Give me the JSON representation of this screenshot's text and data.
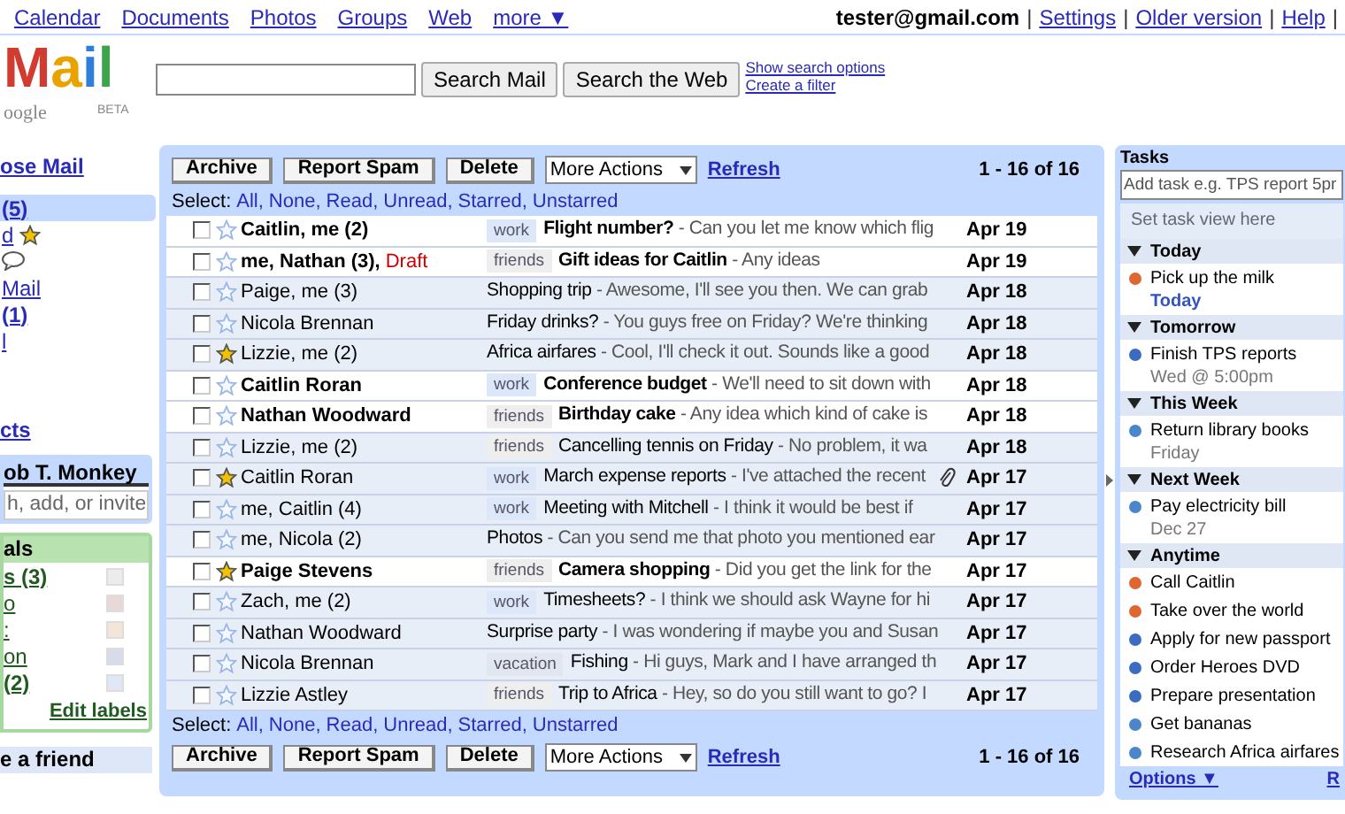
{
  "top_links": [
    "Calendar",
    "Documents",
    "Photos",
    "Groups",
    "Web",
    "more ▼"
  ],
  "account": {
    "email": "tester@gmail.com",
    "separator": "|",
    "links": [
      "Settings",
      "Older version",
      "Help"
    ]
  },
  "logo": {
    "text": "Mail",
    "sub": "oogle",
    "badge": "BETA"
  },
  "search": {
    "buttons": [
      "Search Mail",
      "Search the Web"
    ],
    "links": [
      "Show search options",
      "Create a filter"
    ]
  },
  "sidebar": {
    "compose": "ose Mail",
    "nav": [
      {
        "kind": "plain",
        "label": "(5)",
        "unread": true,
        "selected": true
      },
      {
        "kind": "starred",
        "label": "d",
        "unread": false,
        "selected": false
      },
      {
        "kind": "chats",
        "selected": false
      },
      {
        "kind": "plain",
        "label": "Mail",
        "unread": false,
        "selected": false
      },
      {
        "kind": "plain",
        "label": "(1)",
        "unread": true,
        "selected": false
      },
      {
        "kind": "plain",
        "label": "l",
        "unread": false,
        "selected": false
      }
    ],
    "contacts": "cts",
    "chat": {
      "title": "ob T. Monkey",
      "placeholder": "h, add, or invite"
    },
    "labels": {
      "title": "als",
      "items": [
        {
          "label": "s (3)",
          "unread": true,
          "color": "#ececec"
        },
        {
          "label": "o",
          "unread": false,
          "color": "#e8d8d8"
        },
        {
          "label": ":",
          "unread": false,
          "color": "#f3e6d8"
        },
        {
          "label": "on",
          "unread": false,
          "color": "#d8dcea"
        },
        {
          "label": "(2)",
          "unread": true,
          "color": "#dfe6f4"
        }
      ],
      "edit": "Edit labels"
    },
    "invite": "e a friend"
  },
  "list": {
    "top_toolbar": {
      "actions": [
        "Archive",
        "Report Spam",
        "Delete"
      ],
      "more_actions": "More Actions",
      "refresh": "Refresh",
      "count": "1 - 16 of 16"
    },
    "top_select": {
      "prefix": "Select:",
      "links": [
        "All,",
        "None,",
        "Read,",
        "Unread,",
        "Starred,",
        "Unstarred"
      ]
    },
    "rows": [
      {
        "sender": "Caitlin, me (2)",
        "label": "work",
        "color": "#dde7fa",
        "subject": "Flight number?",
        "snippet": "- Can you let me know which flig",
        "date": "Apr 19",
        "unread": true,
        "starred": false,
        "checked": false,
        "attachment": false
      },
      {
        "sender": "me, Nathan (3),",
        "draft": "Draft",
        "label": "friends",
        "color": "#eeeeee",
        "subject": "Gift ideas for Caitlin",
        "snippet": "- Any ideas",
        "date": "Apr 19",
        "unread": true,
        "starred": false,
        "checked": false,
        "attachment": false
      },
      {
        "sender": "Paige, me (3)",
        "subject": "Shopping trip",
        "snippet": "- Awesome, I'll see you then. We can grab",
        "date": "Apr 18",
        "unread": false,
        "starred": false,
        "checked": false,
        "attachment": false
      },
      {
        "sender": "Nicola Brennan",
        "subject": "Friday drinks?",
        "snippet": "- You guys free on Friday? We're thinking",
        "date": "Apr 18",
        "unread": false,
        "starred": false,
        "checked": false,
        "attachment": false
      },
      {
        "sender": "Lizzie, me (2)",
        "subject": "Africa airfares",
        "snippet": "- Cool, I'll check it out. Sounds like a good",
        "date": "Apr 18",
        "unread": false,
        "starred": true,
        "checked": false,
        "attachment": false
      },
      {
        "sender": "Caitlin Roran",
        "label": "work",
        "color": "#dde7fa",
        "subject": "Conference budget",
        "snippet": "- We'll need to sit down with",
        "date": "Apr 18",
        "unread": true,
        "starred": false,
        "checked": false,
        "attachment": false
      },
      {
        "sender": "Nathan Woodward",
        "label": "friends",
        "color": "#eeeeee",
        "subject": "Birthday cake",
        "snippet": "- Any idea which kind of cake is",
        "date": "Apr 18",
        "unread": true,
        "starred": false,
        "checked": false,
        "attachment": false
      },
      {
        "sender": "Lizzie, me (2)",
        "label": "friends",
        "color": "#eeeeee",
        "subject": "Cancelling tennis on Friday",
        "snippet": "- No problem, it wa",
        "date": "Apr 18",
        "unread": false,
        "starred": false,
        "checked": false,
        "attachment": false
      },
      {
        "sender": "Caitlin Roran",
        "label": "work",
        "color": "#dde7fa",
        "subject": "March expense reports",
        "snippet": "- I've attached the recent",
        "date": "Apr 17",
        "unread": false,
        "starred": true,
        "checked": false,
        "attachment": true
      },
      {
        "sender": "me, Caitlin (4)",
        "label": "work",
        "color": "#dde7fa",
        "subject": "Meeting with Mitchell",
        "snippet": "- I think it would be best if",
        "date": "Apr 17",
        "unread": false,
        "starred": false,
        "checked": false,
        "attachment": false
      },
      {
        "sender": "me, Nicola (2)",
        "subject": "Photos",
        "snippet": "- Can you send me that photo you mentioned ear",
        "date": "Apr 17",
        "unread": false,
        "starred": false,
        "checked": false,
        "attachment": false
      },
      {
        "sender": "Paige Stevens",
        "label": "friends",
        "color": "#eeeeee",
        "subject": "Camera shopping",
        "snippet": "- Did you get the link for the",
        "date": "Apr 17",
        "unread": true,
        "starred": true,
        "checked": false,
        "attachment": false
      },
      {
        "sender": "Zach, me (2)",
        "label": "work",
        "color": "#dde7fa",
        "subject": "Timesheets?",
        "snippet": "- I think we should ask Wayne for hi",
        "date": "Apr 17",
        "unread": false,
        "starred": false,
        "checked": false,
        "attachment": false
      },
      {
        "sender": "Nathan Woodward",
        "subject": "Surprise party",
        "snippet": "- I was wondering if maybe you and Susan",
        "date": "Apr 17",
        "unread": false,
        "starred": false,
        "checked": false,
        "attachment": false
      },
      {
        "sender": "Nicola Brennan",
        "label": "vacation",
        "color": "#e2e6f0",
        "subject": "Fishing",
        "snippet": "- Hi guys, Mark and I have arranged th",
        "date": "Apr 17",
        "unread": false,
        "starred": false,
        "checked": false,
        "attachment": false
      },
      {
        "sender": "Lizzie Astley",
        "label": "friends",
        "color": "#eeeeee",
        "subject": "Trip to Africa",
        "snippet": "- Hey, so do you still want to go? I",
        "date": "Apr 17",
        "unread": false,
        "starred": false,
        "checked": false,
        "attachment": false
      }
    ],
    "bottom_select": {
      "prefix": "Select:",
      "links": [
        "All,",
        "None,",
        "Read,",
        "Unread,",
        "Starred,",
        "Unstarred"
      ]
    },
    "bottom_toolbar": {
      "actions": [
        "Archive",
        "Report Spam",
        "Delete"
      ],
      "more_actions": "More Actions",
      "refresh": "Refresh",
      "count": "1 - 16 of 16"
    }
  },
  "tasks": {
    "title": "Tasks",
    "placeholder": "Add task e.g. TPS report 5pr",
    "view": "Set task view here",
    "sections": [
      {
        "title": "Today",
        "expanded": true,
        "tasks": [
          {
            "title": "Pick up the milk",
            "color": "#dd6633",
            "due": "Today",
            "due_today": true
          }
        ]
      },
      {
        "title": "Tomorrow",
        "expanded": true,
        "tasks": [
          {
            "title": "Finish TPS reports",
            "color": "#3a6cc0",
            "due": "Wed @ 5:00pm",
            "due_today": false
          }
        ]
      },
      {
        "title": "This Week",
        "expanded": true,
        "tasks": [
          {
            "title": "Return library books",
            "color": "#4a86cc",
            "due": "Friday",
            "due_today": false
          }
        ]
      },
      {
        "title": "Next Week",
        "expanded": true,
        "tasks": [
          {
            "title": "Pay electricity bill",
            "color": "#4a86cc",
            "due": "Dec 27",
            "due_today": false
          }
        ]
      },
      {
        "title": "Anytime",
        "expanded": true,
        "tasks": [
          {
            "title": "Call Caitlin",
            "color": "#dd6633"
          },
          {
            "title": "Take over the world",
            "color": "#dd6633"
          },
          {
            "title": "Apply for new passport",
            "color": "#3a6cc0"
          },
          {
            "title": "Order Heroes DVD",
            "color": "#3a6cc0"
          },
          {
            "title": "Prepare presentation",
            "color": "#3a6cc0"
          },
          {
            "title": "Get bananas",
            "color": "#4a86cc"
          },
          {
            "title": "Research Africa airfares",
            "color": "#4a86cc"
          }
        ]
      }
    ],
    "options": "Options ▼",
    "cut_link": "R"
  }
}
